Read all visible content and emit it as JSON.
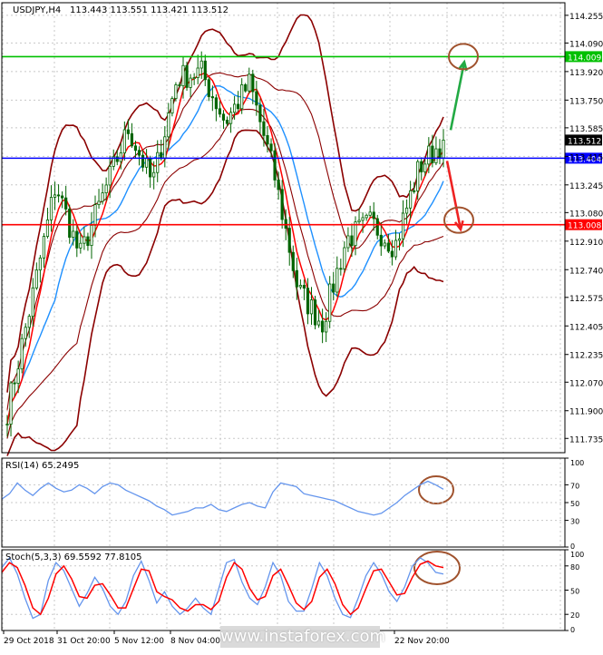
{
  "header": {
    "symbol": "USDJPY,H4",
    "ohlc": "113.443 113.551 113.421 113.512"
  },
  "rsi_label": "RSI(14) 65.2495",
  "stoch_label": "Stoch(5,3,3) 69.5592 77.8105",
  "watermark": "www.instaforex.com",
  "colors": {
    "candle": "#006400",
    "bollinger": "#8b0000",
    "ma_fast": "#ff0000",
    "ma_slow": "#1e90ff",
    "level_green": "#00c000",
    "level_blue": "#0000ff",
    "level_red": "#ff0000",
    "arrow_up": "#22aa44",
    "arrow_down": "#ee2222",
    "ellipse": "#a0522d",
    "osc_main": "#6495ed",
    "osc_signal": "#ff0000",
    "grid": "#c8c8c8"
  },
  "chart_data": [
    {
      "type": "candlestick",
      "title": "USDJPY,H4",
      "ylim": [
        111.65,
        114.33
      ],
      "y_ticks": [
        "114.255",
        "114.090",
        "113.920",
        "113.750",
        "113.585",
        "113.415",
        "113.245",
        "113.080",
        "112.910",
        "112.740",
        "112.575",
        "112.405",
        "112.235",
        "112.070",
        "111.900",
        "111.735"
      ],
      "x_labels": [
        "29 Oct 2018",
        "31 Oct 20:00",
        "5 Nov 12:00",
        "8 Nov 04:00",
        "",
        "",
        "",
        "",
        "22 Nov 20:00"
      ],
      "levels": [
        {
          "label": "114.009",
          "value": 114.009,
          "color": "#00c000"
        },
        {
          "label": "113.404",
          "value": 113.404,
          "color": "#0000ff"
        },
        {
          "label": "113.008",
          "value": 113.008,
          "color": "#ff0000"
        }
      ],
      "current_price": "113.512",
      "keypoints": [
        111.9,
        112.55,
        113.25,
        112.82,
        113.2,
        113.58,
        113.25,
        113.88,
        113.92,
        113.62,
        113.85,
        113.32,
        112.62,
        112.42,
        112.92,
        113.02,
        112.88,
        113.35,
        113.51
      ],
      "arrows": [
        {
          "from": 113.42,
          "to": 114.02,
          "direction": "up"
        },
        {
          "from": 113.42,
          "to": 112.98,
          "direction": "down"
        }
      ]
    },
    {
      "type": "line",
      "title": "RSI(14) 65.2495",
      "ylim": [
        0,
        100
      ],
      "y_ticks": [
        "100",
        "70",
        "50",
        "30",
        "0"
      ],
      "series": [
        {
          "name": "RSI(14)",
          "values": [
            54,
            60,
            72,
            64,
            58,
            66,
            72,
            66,
            62,
            64,
            70,
            66,
            60,
            68,
            72,
            70,
            64,
            60,
            56,
            52,
            46,
            42,
            36,
            38,
            40,
            44,
            44,
            48,
            42,
            40,
            44,
            48,
            50,
            46,
            44,
            62,
            72,
            70,
            68,
            60,
            58,
            56,
            54,
            52,
            48,
            44,
            40,
            38,
            36,
            38,
            44,
            50,
            58,
            64,
            70,
            74,
            70,
            65
          ]
        }
      ]
    },
    {
      "type": "line",
      "title": "Stoch(5,3,3) 69.5592 77.8105",
      "ylim": [
        0,
        100
      ],
      "y_ticks": [
        "100",
        "80",
        "50",
        "20",
        "0"
      ],
      "series": [
        {
          "name": "Main",
          "values": [
            78,
            90,
            70,
            40,
            15,
            20,
            62,
            84,
            74,
            52,
            30,
            46,
            66,
            52,
            30,
            20,
            36,
            68,
            86,
            62,
            34,
            48,
            30,
            20,
            28,
            40,
            28,
            20,
            52,
            84,
            88,
            60,
            40,
            32,
            54,
            84,
            68,
            36,
            24,
            24,
            52,
            84,
            68,
            40,
            20,
            16,
            40,
            68,
            84,
            70,
            48,
            36,
            54,
            80,
            90,
            84,
            72,
            70
          ]
        },
        {
          "name": "Signal",
          "values": [
            72,
            84,
            78,
            56,
            28,
            20,
            40,
            70,
            80,
            64,
            42,
            40,
            56,
            58,
            44,
            28,
            28,
            52,
            76,
            74,
            48,
            42,
            38,
            28,
            24,
            32,
            32,
            26,
            36,
            66,
            84,
            76,
            52,
            38,
            42,
            68,
            76,
            56,
            34,
            26,
            36,
            66,
            76,
            58,
            32,
            20,
            28,
            52,
            74,
            76,
            60,
            44,
            46,
            66,
            82,
            86,
            80,
            78
          ]
        }
      ]
    }
  ]
}
